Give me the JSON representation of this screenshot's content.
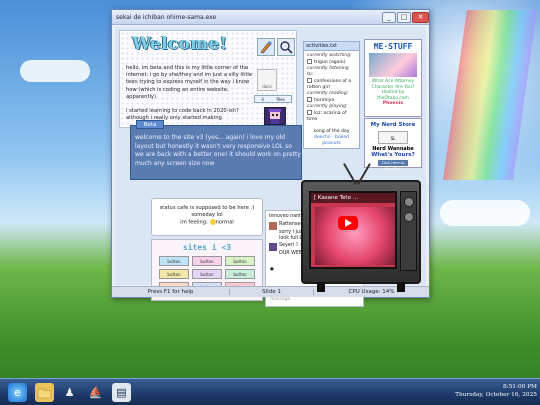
{
  "window": {
    "title": "sekai de ichiban ohime-sama.exe",
    "controls": [
      "_",
      "□",
      "✕"
    ]
  },
  "welcome": {
    "heading": "Welcome!",
    "description": "hello, im beta and this is my little corner of the internet. i go by she/they and im just a silly little teen trying to express myself in the way i know how (which is coding an entire website, apparently)\n\ni started learning to code back in 2020-ish? although i really only started making",
    "doc_label": "docx",
    "stat_value": "4",
    "stat_unit": "files"
  },
  "activities": {
    "header": "activities.txt",
    "currently_watching_label": "currently watching:",
    "watching_item": "trigun (again)",
    "currently_listening_label": "currently listening to:",
    "listening_item": "confessions of a rotten girl",
    "currently_reading_label": "currently reading:",
    "reading_item": "horimiya",
    "currently_playing_label": "currently playing:",
    "playing_item": "loz: ocarina of time",
    "song_label": "song of the day",
    "song_link": "doechii - boiled peanuts"
  },
  "mestuff": {
    "logo": "ME·STUFF",
    "question_line1": "What Ace Attorney Character Are You?",
    "question_line2": "Hosted by theOtaku.com",
    "question_tag": "Phoenix"
  },
  "nerdstore": {
    "line1": "My Nerd Store",
    "tag": "SL",
    "name": "Nerd Wannabe",
    "line2": "What's Yours?",
    "button": "Click Here to Find Out"
  },
  "beta": {
    "tab": "Beta",
    "text": "welcome to the site v3 (yes... again) i love my old layout but honestly it wasn't very responsive LOL so we are back with a better one! it should work on pretty much any screen size now"
  },
  "status": {
    "line1": "status cafe is supposed to be here :)",
    "line2": "someday lol",
    "line3": "im feeling:",
    "mood": "normal"
  },
  "sites": {
    "title": "sites i <3",
    "buttons": [
      "button",
      "button",
      "button",
      "button",
      "button",
      "button",
      "button",
      "button",
      "button"
    ]
  },
  "comments": {
    "c0": "tenuveo nantoka ^^^^w/",
    "c1_name": "Rattenseep",
    "c1_time": "4 months ago",
    "c1_text": "sorry i just needed the cbox to look full LOL",
    "c2_name": "Seyeri",
    "c2_time": "5 months ago",
    "c2_text": "OUR WEBSITE IS SO COOL",
    "cbox_label": "Cbox",
    "name_placeholder": "name",
    "message_placeholder": "message"
  },
  "tv": {
    "video_title": "[ Kasane Teto ..."
  },
  "statusbar": {
    "help": "Press F1 for help",
    "slide": "Slide 1",
    "cpu": "CPU Usage: 14%"
  },
  "taskbar": {
    "time": "8:51:00 PM",
    "date": "Thursday, October 16, 2025",
    "icons": [
      "ie-icon",
      "folder-icon",
      "chess-icon",
      "ship-icon",
      "notepad-icon"
    ]
  }
}
